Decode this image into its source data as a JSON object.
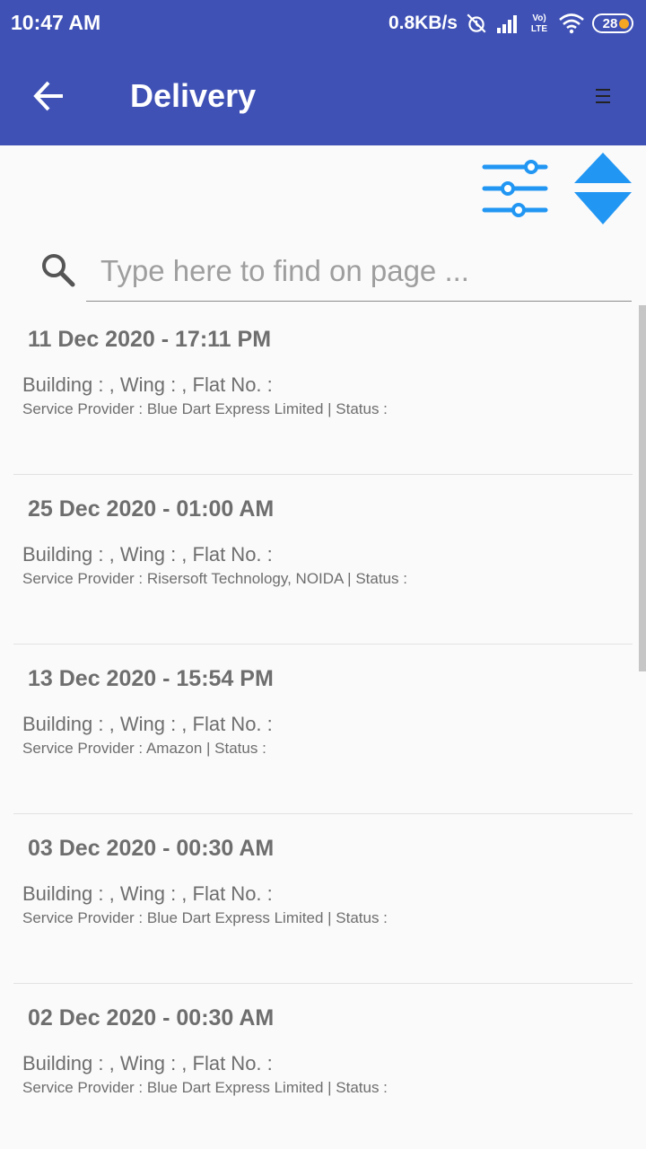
{
  "status_bar": {
    "time": "10:47 AM",
    "speed": "0.8KB/s",
    "battery": "28",
    "volte": "Vo)\nLTE",
    "icons": [
      "alarm-off-icon",
      "signal-icon",
      "volte-icon",
      "wifi-icon",
      "battery-icon"
    ]
  },
  "app_bar": {
    "title": "Delivery",
    "back_icon": "arrow-back-icon",
    "menu_icon": "menu-icon"
  },
  "toolbar": {
    "filter_icon": "filter-sliders-icon",
    "sort_icon": "sort-updown-icon"
  },
  "search": {
    "placeholder": "Type here to find on page ...",
    "value": ""
  },
  "deliveries": [
    {
      "datetime": "11 Dec 2020 - 17:11 PM",
      "address": "Building : , Wing : , Flat No. :",
      "provider": "Service Provider : Blue Dart Express Limited | Status :"
    },
    {
      "datetime": "25 Dec 2020 - 01:00 AM",
      "address": "Building : , Wing : , Flat No. :",
      "provider": "Service Provider : Risersoft Technology, NOIDA | Status :"
    },
    {
      "datetime": "13 Dec 2020 - 15:54 PM",
      "address": "Building : , Wing : , Flat No. :",
      "provider": "Service Provider : Amazon | Status :"
    },
    {
      "datetime": "03 Dec 2020 - 00:30 AM",
      "address": "Building : , Wing : , Flat No. :",
      "provider": "Service Provider : Blue Dart Express Limited | Status :"
    },
    {
      "datetime": "02 Dec 2020 - 00:30 AM",
      "address": "Building : , Wing : , Flat No. :",
      "provider": "Service Provider : Blue Dart Express Limited | Status :"
    }
  ],
  "colors": {
    "primary": "#3f51b5",
    "accent": "#2196f3",
    "text": "#6e6e6e",
    "battery_dot": "#f5a623"
  }
}
